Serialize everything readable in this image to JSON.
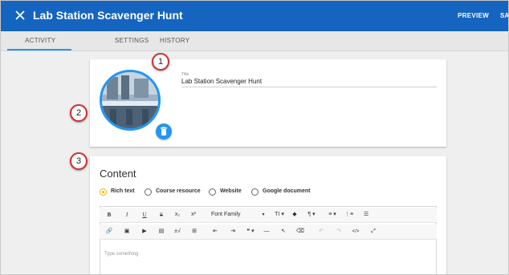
{
  "appbar": {
    "title": "Lab Station Scavenger Hunt",
    "preview_label": "PREVIEW",
    "save_label": "SA",
    "close_icon": "close-icon"
  },
  "tabs": [
    {
      "label": "ACTIVITY",
      "active": true
    },
    {
      "label": "SETTINGS",
      "active": false
    },
    {
      "label": "HISTORY",
      "active": false
    }
  ],
  "details": {
    "title_label": "Title",
    "title_value": "Lab Station Scavenger Hunt"
  },
  "callouts": [
    "1",
    "2",
    "3"
  ],
  "content": {
    "heading": "Content",
    "options": [
      {
        "label": "Rich text",
        "selected": true
      },
      {
        "label": "Course resource",
        "selected": false
      },
      {
        "label": "Website",
        "selected": false
      },
      {
        "label": "Google document",
        "selected": false
      }
    ],
    "editor": {
      "toolbar_row1": [
        "B",
        "I",
        "U",
        "S",
        "x₂",
        "x²",
        "Font Family",
        "▾",
        "TI ▾",
        "◆",
        "¶ ▾",
        "≡ ▾",
        "⋮≡",
        "☰"
      ],
      "toolbar_row2": [
        "🔗",
        "▣",
        "▶",
        "▤",
        "±√",
        "⊞",
        "⇤",
        "⇥",
        "❝ ▾",
        "—",
        "↖",
        "⌫",
        "↶",
        "↷",
        "</>",
        "⤢"
      ],
      "placeholder": "Type something"
    }
  },
  "colors": {
    "appbar": "#1565c0",
    "accent": "#2196f3",
    "callout_border": "#d32f2f",
    "radio_selected": "#f4b400"
  }
}
